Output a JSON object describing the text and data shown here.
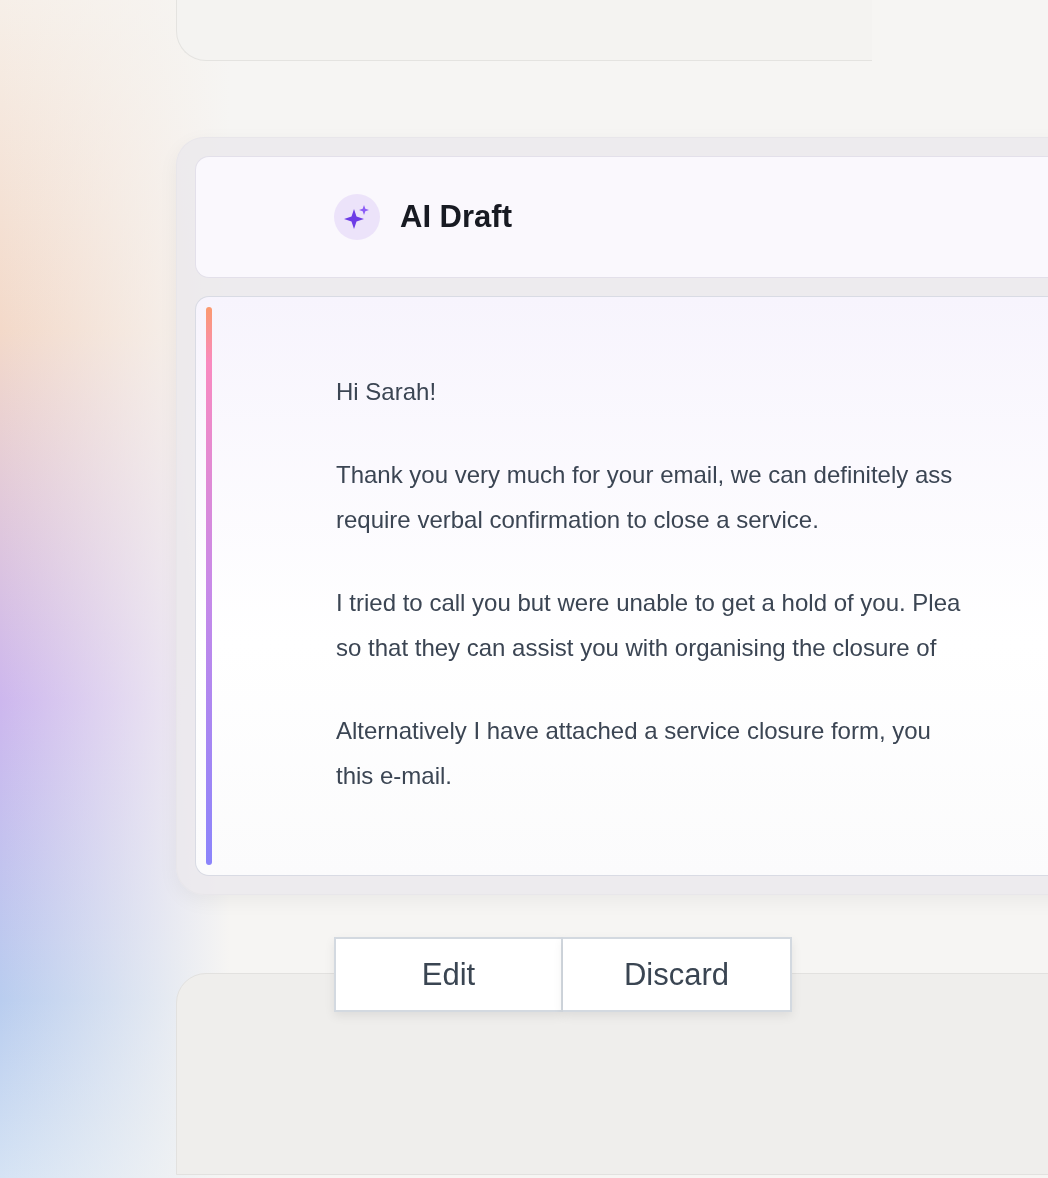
{
  "header": {
    "title": "AI Draft"
  },
  "message": {
    "paragraphs": [
      [
        "Hi Sarah!"
      ],
      [
        "Thank you very much for your email, we can definitely ass",
        "require verbal confirmation to close a service."
      ],
      [
        "I tried to call you but were unable to get a hold of you. Plea",
        "so that they can assist you with organising the closure of"
      ],
      [
        "Alternatively I have attached a service closure form, you",
        "this e-mail."
      ]
    ]
  },
  "buttons": [
    {
      "label": "Edit"
    },
    {
      "label": "Discard"
    }
  ]
}
